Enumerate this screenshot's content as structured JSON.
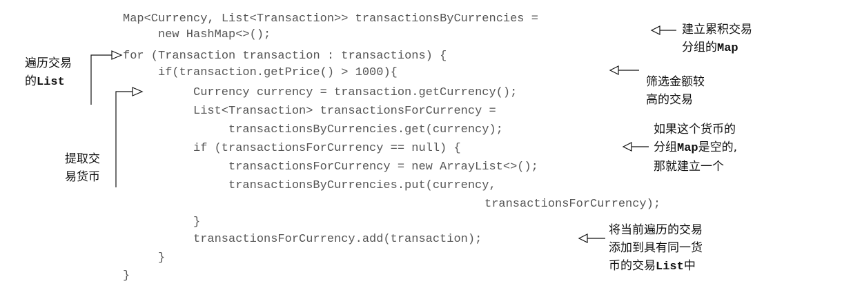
{
  "code_lines": [
    "Map<Currency, List<Transaction>> transactionsByCurrencies =",
    "new HashMap<>();",
    "for (Transaction transaction : transactions) {",
    "if(transaction.getPrice() > 1000){",
    "Currency currency = transaction.getCurrency();",
    "List<Transaction> transactionsForCurrency =",
    "transactionsByCurrencies.get(currency);",
    "if (transactionsForCurrency == null) {",
    "transactionsForCurrency = new ArrayList<>();",
    "transactionsByCurrencies.put(currency,",
    "transactionsForCurrency);",
    "}",
    "transactionsForCurrency.add(transaction);",
    "}",
    "}"
  ],
  "annotations": {
    "create_map": {
      "line1": "建立累积交易",
      "line2_text": "分组的",
      "line2_mono": "Map"
    },
    "filter": {
      "line1": "筛选金额较",
      "line2": "高的交易"
    },
    "empty_map": {
      "line1": "如果这个货币的",
      "line2_text": "分组",
      "line2_mono": "Map",
      "line2_tail": "是空的,",
      "line3": "那就建立一个"
    },
    "add_tx": {
      "line1": "将当前遍历的交易",
      "line2": "添加到具有同一货",
      "line3_text": "币的交易",
      "line3_mono": "List",
      "line3_tail": "中"
    },
    "iterate": {
      "line1": "遍历交易",
      "line2_text": "的",
      "line2_mono": "List"
    },
    "extract": {
      "line1": "提取交",
      "line2": "易货币"
    }
  }
}
